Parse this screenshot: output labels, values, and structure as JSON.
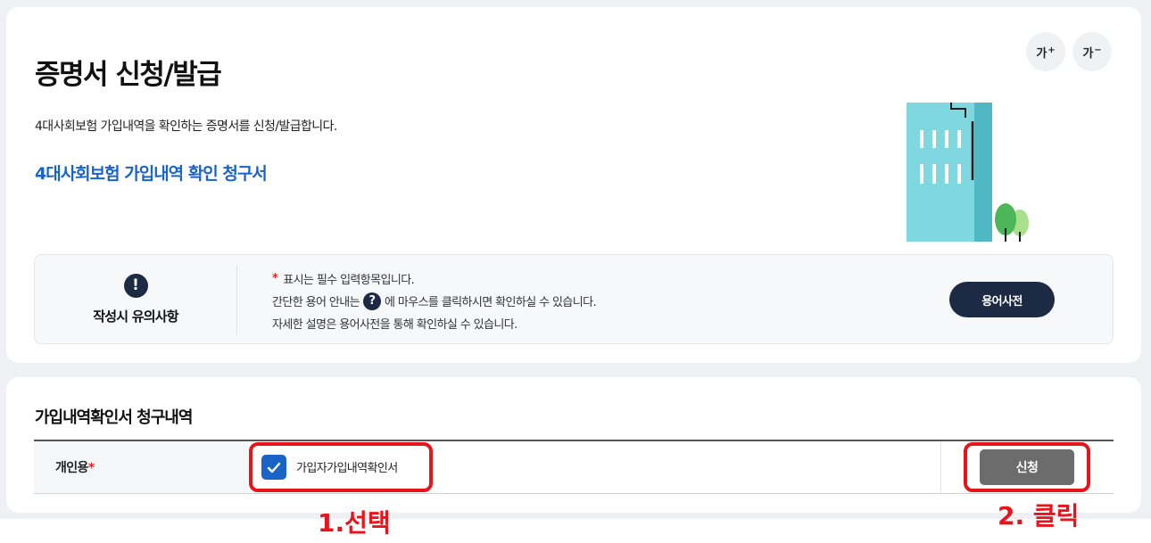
{
  "font_controls": {
    "increase_label": "가",
    "increase_mark": "+",
    "decrease_label": "가",
    "decrease_mark": "−"
  },
  "header": {
    "title": "증명서 신청/발급",
    "description": "4대사회보험 가입내역을 확인하는 증명서를 신청/발급합니다.",
    "document_link": "4대사회보험 가입내역 확인 청구서"
  },
  "notice": {
    "title": "작성시 유의사항",
    "icon": "exclamation-icon",
    "required_star": "*",
    "line1": "표시는 필수 입력항목입니다.",
    "line2_before": "간단한 용어 안내는",
    "line2_icon": "?",
    "line2_after": "에 마우스를 클릭하시면 확인하실 수 있습니다.",
    "line3": "자세한 설명은 용어사전을 통해 확인하실 수 있습니다.",
    "glossary_button": "용어사전"
  },
  "section": {
    "title": "가입내역확인서 청구내역",
    "row": {
      "label": "개인용",
      "required": "*",
      "checkbox_label": "가입자가입내역확인서",
      "checked": true,
      "apply_button": "신청"
    }
  },
  "annotations": {
    "step1": "1.선택",
    "step2": "2. 클릭"
  },
  "colors": {
    "accent_blue": "#1a64c8",
    "navy": "#1d2a44",
    "highlight_red": "#e8141b",
    "building_teal": "#5fc8d3"
  }
}
